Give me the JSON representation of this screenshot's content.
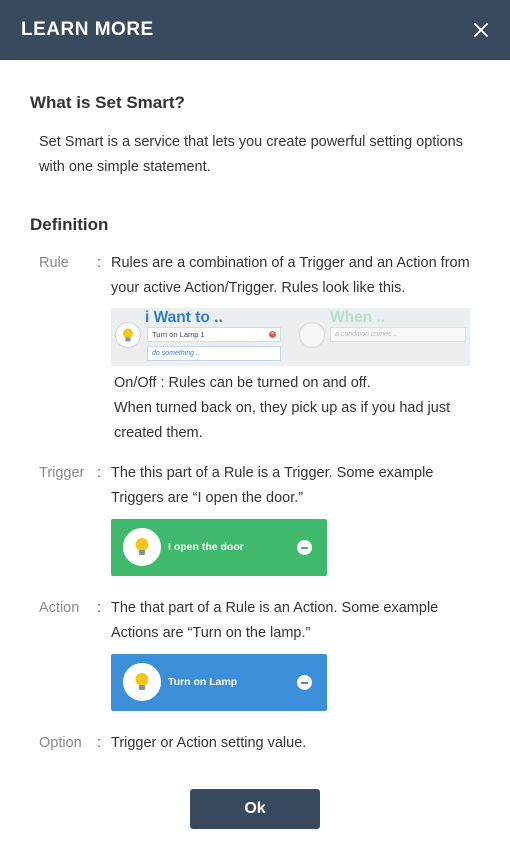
{
  "header": {
    "title": "LEARN MORE",
    "close_icon": "close-icon"
  },
  "intro": {
    "title": "What is Set Smart?",
    "text": "Set Smart is a service that lets you create powerful setting options with one simple statement."
  },
  "definition": {
    "title": "Definition",
    "colon": ":",
    "rule": {
      "term": "Rule",
      "text": "Rules are a combination of a Trigger and an Action from your active Action/Trigger. Rules look like this.",
      "example": {
        "i_want": "i Want to ..",
        "field1": "Turn on Lamp 1",
        "field2": "do something ..",
        "when": "When ..",
        "field3": "a condition comes .."
      },
      "note_line1": "On/Off : Rules can be turned on and off.",
      "note_line2": "When turned back on, they pick up as if you had just created them."
    },
    "trigger": {
      "term": "Trigger",
      "text": "The this part of a Rule is a Trigger. Some example Triggers are “I open the door.”",
      "card_label": "I open the door",
      "card_color": "#3fba6c"
    },
    "action": {
      "term": "Action",
      "text": "The that part of a Rule is an Action. Some example Actions are “Turn on the lamp.”",
      "card_label": "Turn on Lamp",
      "card_color": "#3b8fd9"
    },
    "option": {
      "term": "Option",
      "text": "Trigger or Action setting value."
    }
  },
  "footer": {
    "ok_label": "Ok"
  },
  "colors": {
    "header_bg": "#394a5e",
    "accent_blue": "#2f7fc8"
  }
}
